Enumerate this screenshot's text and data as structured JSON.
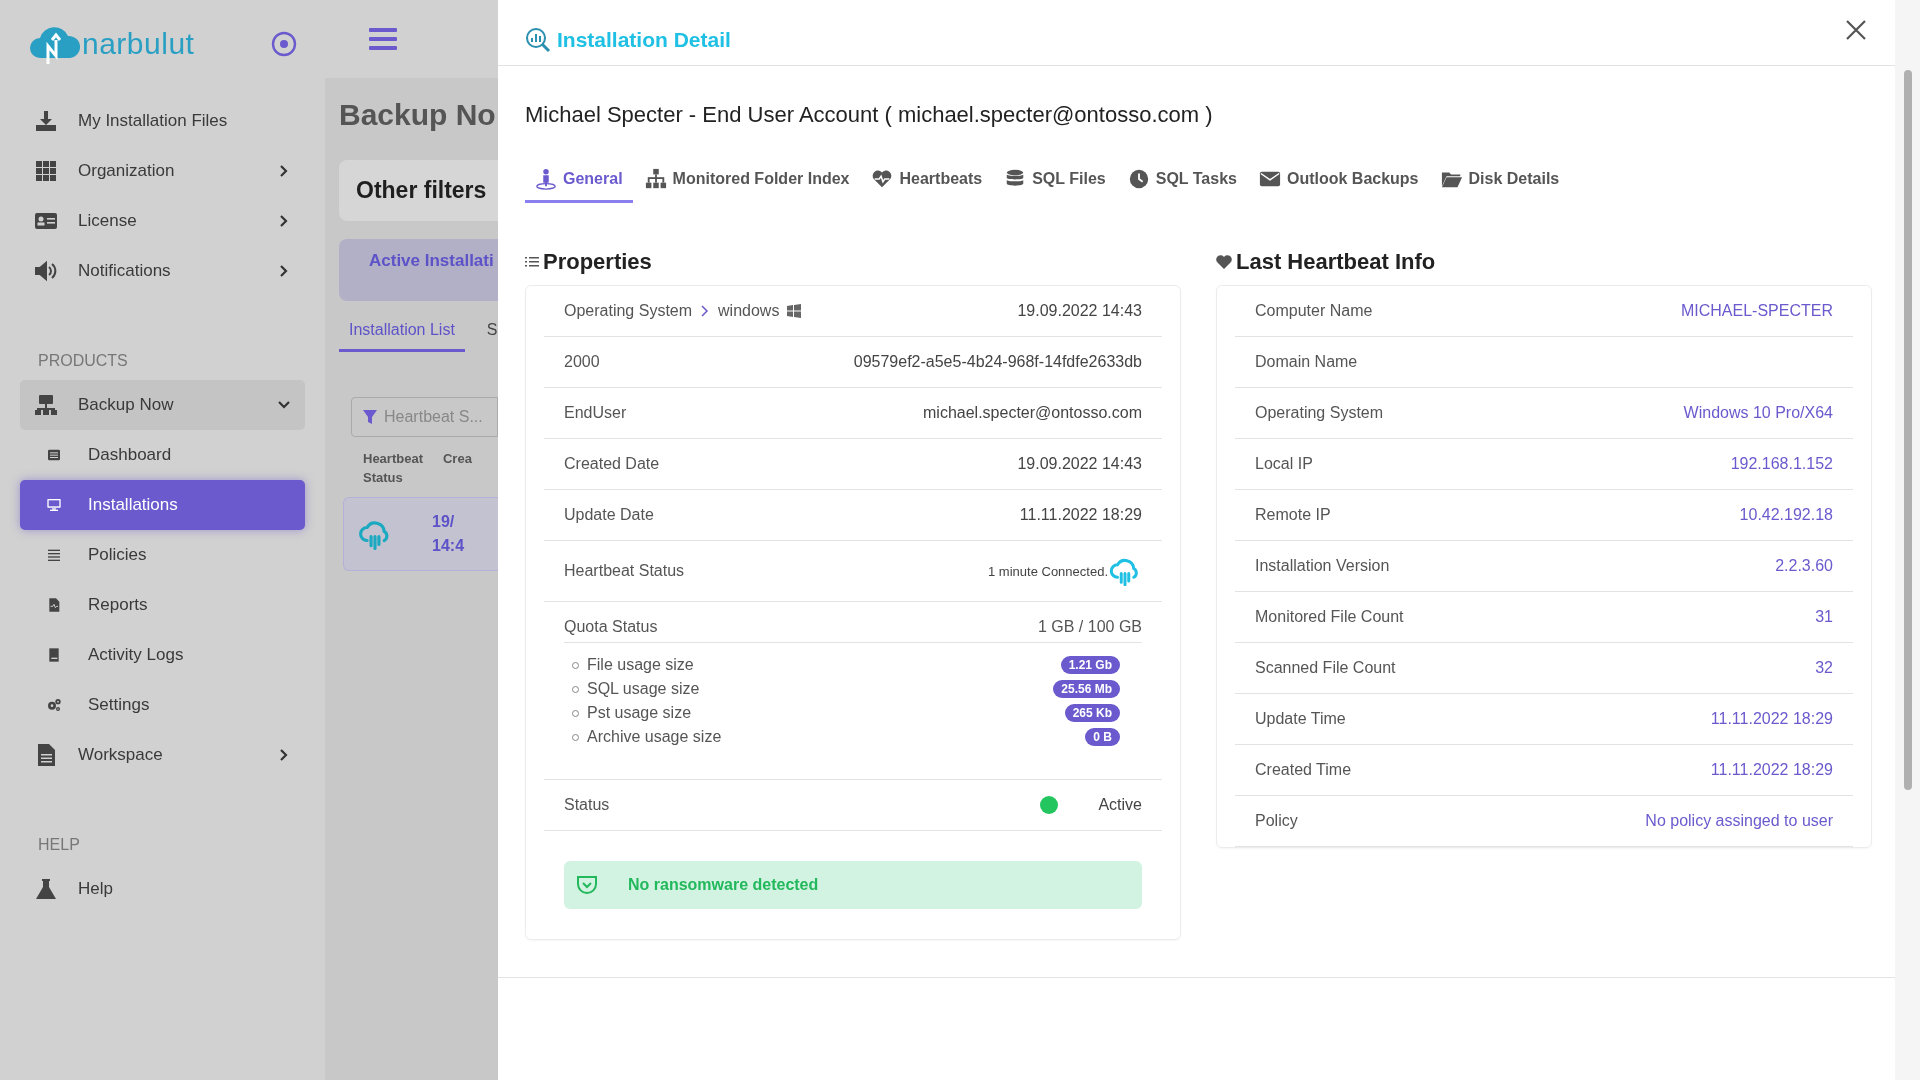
{
  "sidebar": {
    "logo": "narbulut",
    "items": [
      {
        "kind": "link",
        "label": "My Installation Files"
      },
      {
        "kind": "group",
        "label": "Organization",
        "expanded": false
      },
      {
        "kind": "group",
        "label": "License",
        "expanded": false
      },
      {
        "kind": "group",
        "label": "Notifications",
        "expanded": false
      },
      {
        "kind": "section",
        "label": "PRODUCTS"
      },
      {
        "kind": "group",
        "label": "Backup Now",
        "expanded": true
      },
      {
        "kind": "subitem",
        "label": "Dashboard",
        "selected": false
      },
      {
        "kind": "subitem",
        "label": "Installations",
        "selected": true
      },
      {
        "kind": "subitem",
        "label": "Policies",
        "selected": false
      },
      {
        "kind": "subitem",
        "label": "Reports",
        "selected": false
      },
      {
        "kind": "subitem",
        "label": "Activity Logs",
        "selected": false
      },
      {
        "kind": "subitem",
        "label": "Settings",
        "selected": false
      },
      {
        "kind": "group",
        "label": "Workspace",
        "expanded": false
      },
      {
        "kind": "section",
        "label": "HELP"
      },
      {
        "kind": "link",
        "label": "Help"
      }
    ]
  },
  "background_page": {
    "title": "Backup No",
    "filters_title": "Other filters",
    "active_card": "Active Installati",
    "tabs": [
      {
        "label": "Installation List",
        "selected": true
      },
      {
        "label": "S",
        "selected": false
      }
    ],
    "filter": {
      "placeholder": "Heartbeat S..."
    },
    "columns": [
      "Heartbeat Status",
      "Crea"
    ],
    "rows": [
      {
        "date": "19/",
        "time": "14:4"
      }
    ]
  },
  "modal": {
    "title": "Installation Detail",
    "heading": "Michael Specter - End User Account ( michael.specter@ontosso.com )",
    "tabs": [
      {
        "label": "General",
        "selected": true
      },
      {
        "label": "Monitored Folder Index",
        "selected": false
      },
      {
        "label": "Heartbeats",
        "selected": false
      },
      {
        "label": "SQL Files",
        "selected": false
      },
      {
        "label": "SQL Tasks",
        "selected": false
      },
      {
        "label": "Outlook Backups",
        "selected": false
      },
      {
        "label": "Disk Details",
        "selected": false
      }
    ],
    "properties": {
      "title": "Properties",
      "rows": [
        {
          "kind": "os",
          "label": "Operating System",
          "value": "windows",
          "date": "19.09.2022 14:43"
        },
        {
          "kind": "plain",
          "label": "2000",
          "value": "09579ef2-a5e5-4b24-968f-14fdfe2633db"
        },
        {
          "kind": "plain",
          "label": "EndUser",
          "value": "michael.specter@ontosso.com"
        },
        {
          "kind": "plain",
          "label": "Created Date",
          "value": "19.09.2022 14:43"
        },
        {
          "kind": "plain",
          "label": "Update Date",
          "value": "11.11.2022 18:29"
        },
        {
          "kind": "heartbeat",
          "label": "Heartbeat Status",
          "value": "1 minute Connected."
        },
        {
          "kind": "quota",
          "label": "Quota Status",
          "value": "1 GB / 100 GB",
          "usage": [
            {
              "label": "File usage size",
              "value": "1.21 Gb"
            },
            {
              "label": "SQL usage size",
              "value": "25.56 Mb"
            },
            {
              "label": "Pst usage size",
              "value": "265 Kb"
            },
            {
              "label": "Archive usage size",
              "value": "0 B"
            }
          ]
        },
        {
          "kind": "status",
          "label": "Status",
          "value": "Active",
          "color": "#22c55e"
        }
      ],
      "alert": "No ransomware detected"
    },
    "heartbeat_info": {
      "title": "Last Heartbeat Info",
      "rows": [
        {
          "label": "Computer Name",
          "value": "MICHAEL-SPECTER"
        },
        {
          "label": "Domain Name"
        },
        {
          "label": "Operating System",
          "value": "Windows 10 Pro/X64"
        },
        {
          "label": "Local IP",
          "value": "192.168.1.152"
        },
        {
          "label": "Remote IP",
          "value": "10.42.192.18"
        },
        {
          "label": "Installation Version",
          "value": "2.2.3.60"
        },
        {
          "label": "Monitored File Count",
          "value": "31"
        },
        {
          "label": "Scanned File Count",
          "value": "32"
        },
        {
          "label": "Update Time",
          "value": "11.11.2022 18:29"
        },
        {
          "label": "Created Time",
          "value": "11.11.2022 18:29"
        },
        {
          "label": "Policy",
          "value": "No policy assinged to user"
        }
      ]
    }
  }
}
